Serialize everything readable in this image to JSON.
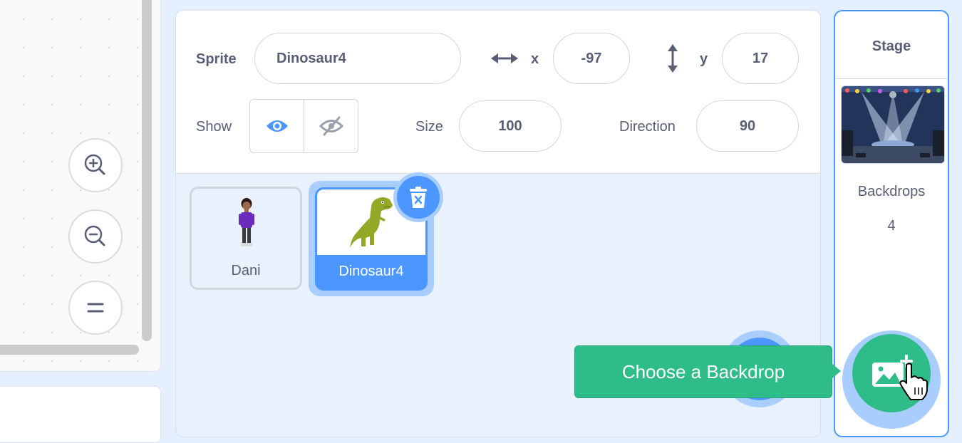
{
  "sprite_info": {
    "sprite_label": "Sprite",
    "sprite_name": "Dinosaur4",
    "x_label": "x",
    "x_value": "-97",
    "y_label": "y",
    "y_value": "17",
    "show_label": "Show",
    "size_label": "Size",
    "size_value": "100",
    "direction_label": "Direction",
    "direction_value": "90"
  },
  "sprites": [
    {
      "name": "Dani",
      "selected": false
    },
    {
      "name": "Dinosaur4",
      "selected": true
    }
  ],
  "stage": {
    "title": "Stage",
    "backdrops_label": "Backdrops",
    "backdrops_count": "4"
  },
  "tooltip": {
    "text": "Choose a Backdrop"
  },
  "colors": {
    "accent": "#4c97ff",
    "green": "#2ebd89",
    "text": "#575e75"
  },
  "icons": [
    "zoom-in-icon",
    "zoom-out-icon",
    "zoom-reset-icon",
    "eye-icon",
    "eye-hidden-icon",
    "trash-icon",
    "horizontal-arrows-icon",
    "vertical-arrows-icon",
    "choose-backdrop-icon",
    "pointer-cursor-icon"
  ]
}
